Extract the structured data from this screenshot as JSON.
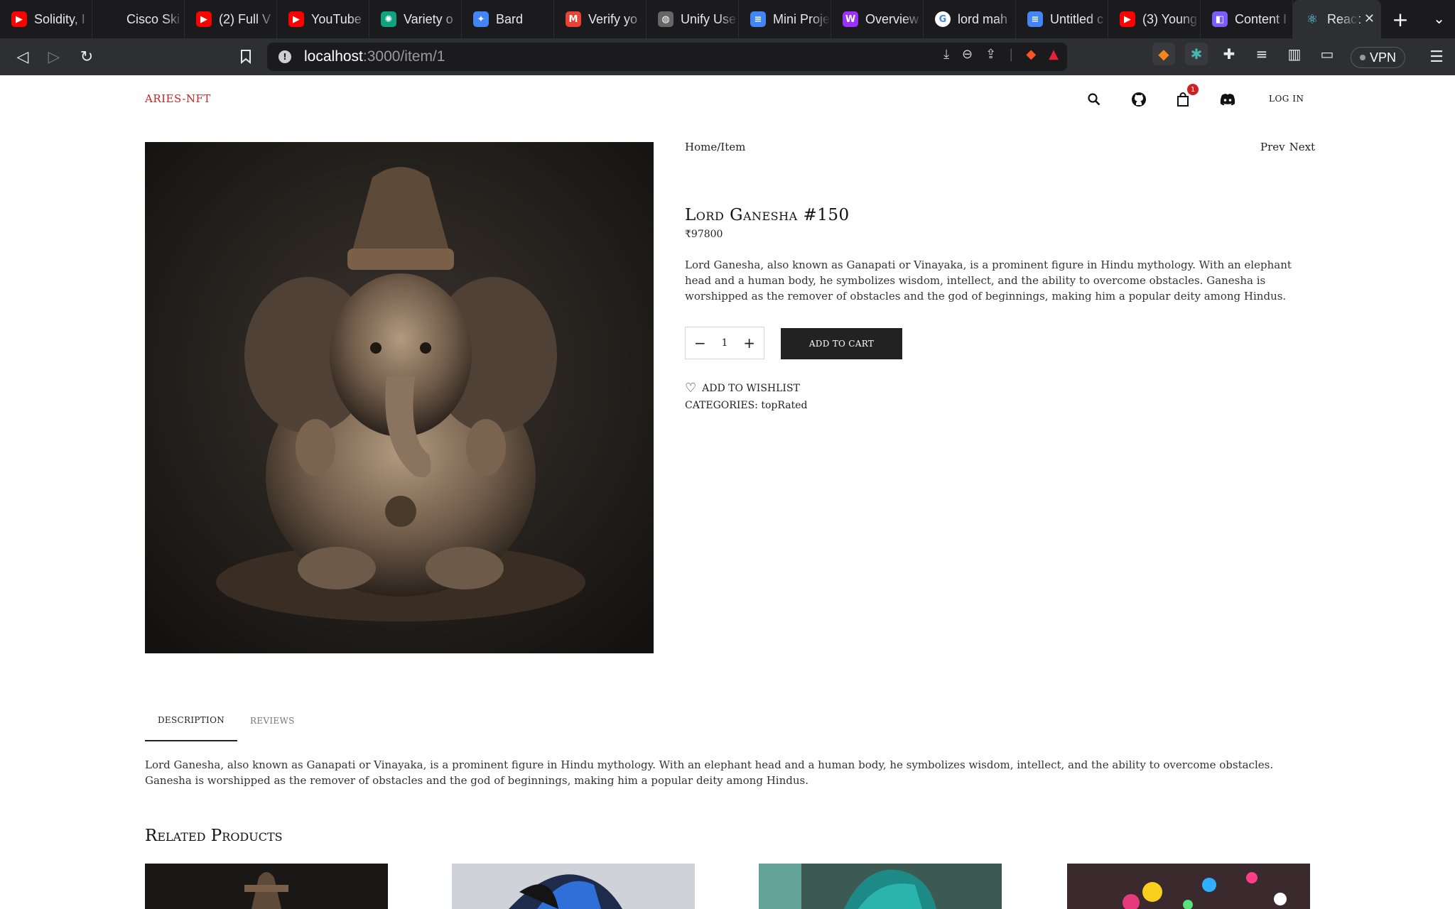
{
  "browser": {
    "tabs": [
      {
        "title": "Solidity, I",
        "icon": "youtube-icon",
        "color": "#ff0000"
      },
      {
        "title": "Cisco Ski",
        "icon": "cisco-icon",
        "color": "#1b1b1d"
      },
      {
        "title": "(2) Full V",
        "icon": "youtube-icon",
        "color": "#ff0000"
      },
      {
        "title": "YouTube",
        "icon": "youtube-music-icon",
        "color": "#ff0000"
      },
      {
        "title": "Variety o",
        "icon": "chatgpt-icon",
        "color": "#10a37f"
      },
      {
        "title": "Bard",
        "icon": "bard-icon",
        "color": "#4285f4"
      },
      {
        "title": "Verify yo",
        "icon": "gmail-icon",
        "color": "#ea4335"
      },
      {
        "title": "Unify Use",
        "icon": "globe-icon",
        "color": "#666666"
      },
      {
        "title": "Mini Proje",
        "icon": "docs-icon",
        "color": "#4285f4"
      },
      {
        "title": "Overview",
        "icon": "webflow-icon",
        "color": "#9b30ff"
      },
      {
        "title": "lord mah",
        "icon": "google-icon",
        "color": "#ffffff"
      },
      {
        "title": "Untitled c",
        "icon": "docs-icon",
        "color": "#4285f4"
      },
      {
        "title": "(3) Young",
        "icon": "youtube-icon",
        "color": "#ff0000"
      },
      {
        "title": "Content I",
        "icon": "content-icon",
        "color": "#7b5cff"
      },
      {
        "title": "React",
        "icon": "react-icon",
        "color": "#61dafb"
      }
    ],
    "url_host": "localhost",
    "url_path": ":3000/item/1",
    "vpn_label": "VPN"
  },
  "site": {
    "brand": "ARIES-NFT",
    "cart_count": "1",
    "login_label": "LOG IN"
  },
  "product": {
    "breadcrumb": "Home/Item",
    "prev_label": "Prev",
    "next_label": "Next",
    "title": "Lord Ganesha #150",
    "price": "₹97800",
    "description": "Lord Ganesha, also known as Ganapati or Vinayaka, is a prominent figure in Hindu mythology. With an elephant head and a human body, he symbolizes wisdom, intellect, and the ability to overcome obstacles. Ganesha is worshipped as the remover of obstacles and the god of beginnings, making him a popular deity among Hindus.",
    "quantity": "1",
    "add_to_cart_label": "ADD TO CART",
    "wishlist_label": "ADD TO WISHLIST",
    "categories_label": "CATEGORIES:",
    "categories_value": "topRated"
  },
  "info_tabs": {
    "description_label": "DESCRIPTION",
    "reviews_label": "REVIEWS",
    "body": "Lord Ganesha, also known as Ganapati or Vinayaka, is a prominent figure in Hindu mythology. With an elephant head and a human body, he symbolizes wisdom, intellect, and the ability to overcome obstacles. Ganesha is worshipped as the remover of obstacles and the god of beginnings, making him a popular deity among Hindus."
  },
  "related": {
    "title": "Related Products"
  }
}
